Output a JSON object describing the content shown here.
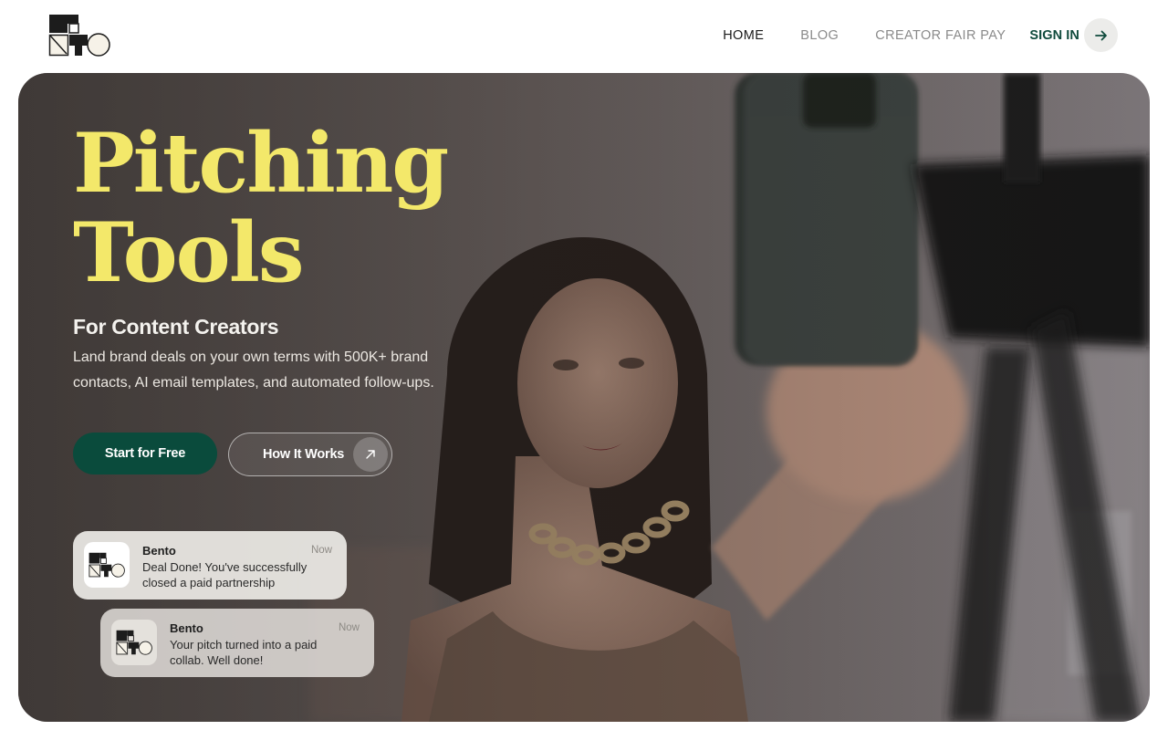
{
  "brand": {
    "logo_text": "BENTO"
  },
  "nav": {
    "items": [
      {
        "label": "HOME",
        "active": true
      },
      {
        "label": "BLOG",
        "active": false
      },
      {
        "label": "CREATOR FAIR PAY",
        "active": false
      }
    ],
    "signin_label": "SIGN IN",
    "signin_icon": "arrow-right-icon"
  },
  "hero": {
    "title_line1": "Pitching",
    "title_line2": "Tools",
    "subtitle": "For Content Creators",
    "description": "Land brand deals on your own terms with 500K+ brand contacts, AI email templates, and automated follow-ups.",
    "primary_button": "Start for Free",
    "secondary_button": "How It Works",
    "secondary_icon": "arrow-up-right-icon"
  },
  "notifications": [
    {
      "app": "Bento",
      "time": "Now",
      "message": "Deal Done! You've successfully closed a paid partnership",
      "icon": "bento-logo-icon"
    },
    {
      "app": "Bento",
      "time": "Now",
      "message": "Your pitch turned into a paid collab. Well done!",
      "icon": "bento-logo-icon"
    }
  ],
  "colors": {
    "title_yellow": "#f3e86a",
    "brand_green": "#0a4b3c",
    "signin_green": "#0f4a3c"
  }
}
